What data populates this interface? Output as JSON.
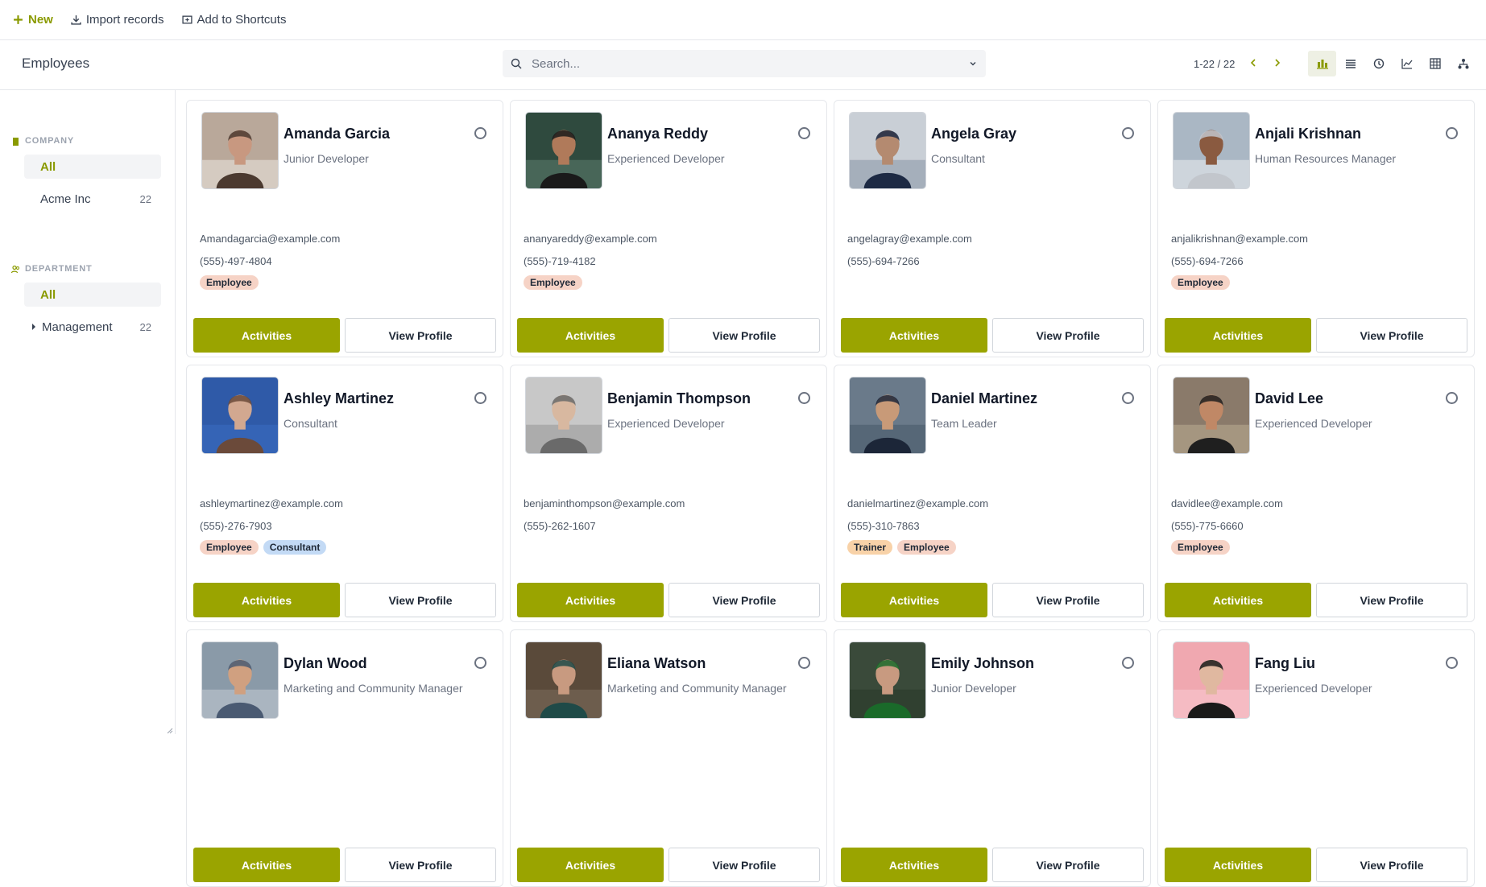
{
  "topbar": {
    "new_label": "New",
    "import_label": "Import records",
    "shortcut_label": "Add to Shortcuts"
  },
  "control": {
    "title": "Employees",
    "search_placeholder": "Search...",
    "pager": "1-22 / 22"
  },
  "sidebar": {
    "company_header": "COMPANY",
    "company_all": "All",
    "company_item": "Acme Inc",
    "company_count": "22",
    "department_header": "DEPARTMENT",
    "department_all": "All",
    "department_item": "Management",
    "department_count": "22"
  },
  "cards": {
    "activities_label": "Activities",
    "view_label": "View Profile",
    "items": [
      {
        "name": "Amanda Garcia",
        "job": "Junior Developer",
        "email": "Amandagarcia@example.com",
        "phone": "(555)-497-4804",
        "tags": [
          "Employee"
        ]
      },
      {
        "name": "Ananya Reddy",
        "job": "Experienced Developer",
        "email": "ananyareddy@example.com",
        "phone": "(555)-719-4182",
        "tags": [
          "Employee"
        ]
      },
      {
        "name": "Angela Gray",
        "job": "Consultant",
        "email": "angelagray@example.com",
        "phone": "(555)-694-7266",
        "tags": []
      },
      {
        "name": "Anjali Krishnan",
        "job": "Human Resources Manager",
        "email": "anjalikrishnan@example.com",
        "phone": "(555)-694-7266",
        "tags": [
          "Employee"
        ]
      },
      {
        "name": "Ashley Martinez",
        "job": "Consultant",
        "email": "ashleymartinez@example.com",
        "phone": "(555)-276-7903",
        "tags": [
          "Employee",
          "Consultant"
        ]
      },
      {
        "name": "Benjamin Thompson",
        "job": "Experienced Developer",
        "email": "benjaminthompson@example.com",
        "phone": "(555)-262-1607",
        "tags": []
      },
      {
        "name": "Daniel Martinez",
        "job": "Team Leader",
        "email": "danielmartinez@example.com",
        "phone": "(555)-310-7863",
        "tags": [
          "Trainer",
          "Employee"
        ]
      },
      {
        "name": "David Lee",
        "job": "Experienced Developer",
        "email": "davidlee@example.com",
        "phone": "(555)-775-6660",
        "tags": [
          "Employee"
        ]
      },
      {
        "name": "Dylan Wood",
        "job": "Marketing and Community Manager",
        "email": "",
        "phone": "",
        "tags": []
      },
      {
        "name": "Eliana Watson",
        "job": "Marketing and Community Manager",
        "email": "",
        "phone": "",
        "tags": []
      },
      {
        "name": "Emily Johnson",
        "job": "Junior Developer",
        "email": "",
        "phone": "",
        "tags": []
      },
      {
        "name": "Fang Liu",
        "job": "Experienced Developer",
        "email": "",
        "phone": "",
        "tags": []
      }
    ]
  },
  "colors": {
    "accent": "#9aa400",
    "tag_employee": "#f6d3c6",
    "tag_consultant": "#c3daf5",
    "tag_trainer": "#f8d2a8"
  }
}
